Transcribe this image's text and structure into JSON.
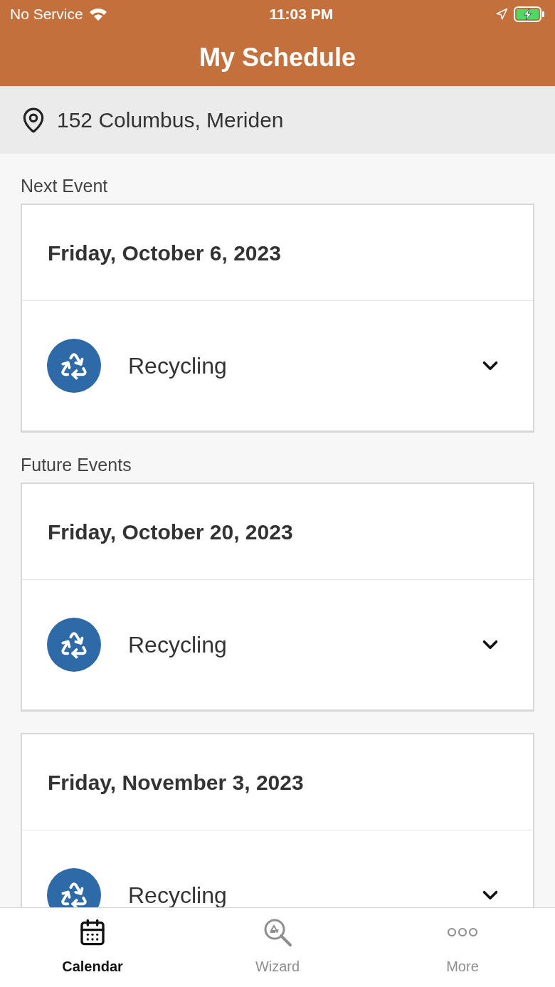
{
  "status_bar": {
    "carrier": "No Service",
    "time": "11:03 PM"
  },
  "header": {
    "title": "My Schedule"
  },
  "address": "152 Columbus, Meriden",
  "sections": [
    {
      "label": "Next Event",
      "events": [
        {
          "date": "Friday, October 6, 2023",
          "items": [
            {
              "name": "Recycling",
              "expanded": false
            }
          ]
        }
      ]
    },
    {
      "label": "Future Events",
      "events": [
        {
          "date": "Friday, October 20, 2023",
          "items": [
            {
              "name": "Recycling",
              "expanded": false
            }
          ]
        },
        {
          "date": "Friday, November 3, 2023",
          "items": [
            {
              "name": "Recycling",
              "expanded": false
            }
          ]
        }
      ]
    }
  ],
  "tab_bar": [
    {
      "label": "Calendar",
      "kind": "calendar",
      "selected": true
    },
    {
      "label": "Wizard",
      "kind": "wizard",
      "selected": false
    },
    {
      "label": "More",
      "kind": "more",
      "selected": false
    }
  ]
}
